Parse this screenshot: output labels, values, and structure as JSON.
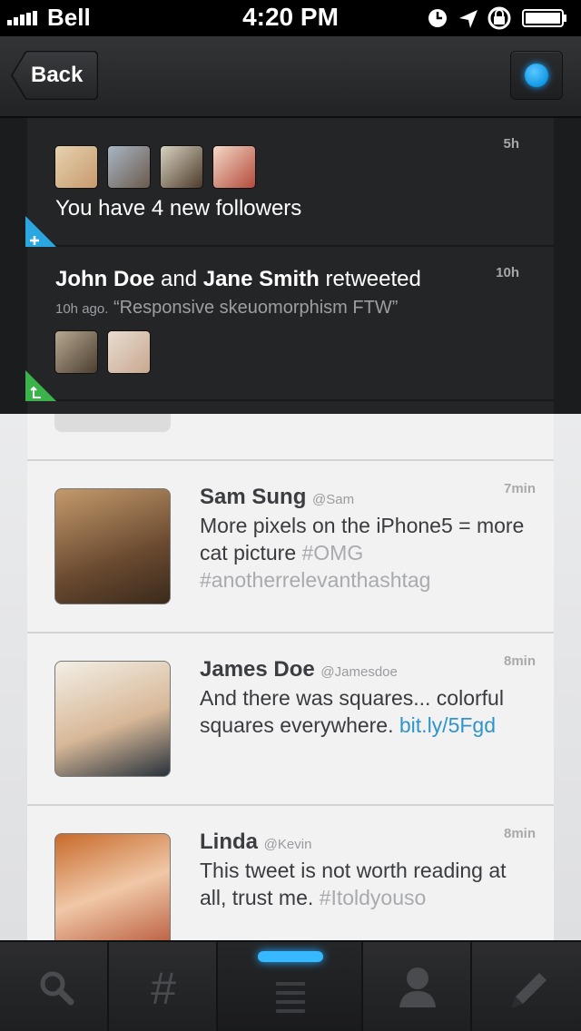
{
  "status_bar": {
    "carrier": "Bell",
    "time": "4:20 PM"
  },
  "navbar": {
    "back_label": "Back"
  },
  "notifications": [
    {
      "type": "followers",
      "text": "You have 4 new followers",
      "time": "5h",
      "icon": "plus-icon",
      "corner_color": "#2aa6e0"
    },
    {
      "type": "retweet",
      "user1": "John Doe",
      "conjunction": " and ",
      "user2": "Jane Smith",
      "action": " retweeted",
      "ago": "10h ago.",
      "quote": " “Responsive skeuomorphism FTW”",
      "time": "10h",
      "icon": "retweet-icon",
      "corner_color": "#3cb24a"
    }
  ],
  "tweets": [
    {
      "name": "Sam Sung",
      "handle": "@Sam",
      "text": "More pixels on the iPhone5 = more cat picture ",
      "tag": "#OMG",
      "tag2": " #anotherrelevanthashtag",
      "time": "7min"
    },
    {
      "name": "James Doe",
      "handle": "@Jamesdoe",
      "text": "And there was squares... colorful squares everywhere. ",
      "link": "bit.ly/5Fgd",
      "time": "8min"
    },
    {
      "name": "Linda",
      "handle": "@Kevin",
      "text": "This tweet is not worth reading at all, trust me. ",
      "tag": "#Itoldyouso",
      "time": "8min"
    }
  ],
  "tabbar": {
    "tabs": [
      {
        "icon": "search-icon"
      },
      {
        "icon": "hashtag-icon",
        "label": "#"
      },
      {
        "icon": "list-icon",
        "active": true
      },
      {
        "icon": "profile-icon"
      },
      {
        "icon": "compose-icon"
      }
    ],
    "accent": "#38b8ff"
  }
}
